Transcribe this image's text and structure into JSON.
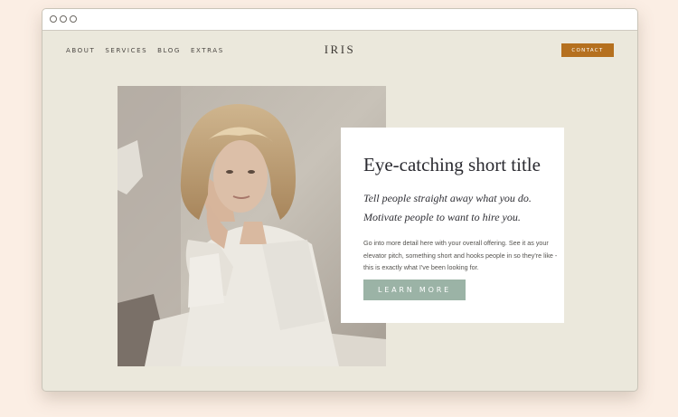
{
  "nav": {
    "items": [
      {
        "label": "ABOUT"
      },
      {
        "label": "SERVICES"
      },
      {
        "label": "BLOG"
      },
      {
        "label": "EXTRAS"
      }
    ],
    "contact_label": "CONTACT"
  },
  "logo": "IRIS",
  "hero": {
    "title": "Eye-catching short title",
    "tagline": "Tell people straight away what you do. Motivate people to want to hire you.",
    "body": "Go into more detail here with your overall offering. See it as your elevator pitch, something short and hooks people in so they're like - this is exactly what I've been looking for.",
    "cta_label": "LEARN MORE"
  },
  "colors": {
    "page_bg": "#fbeee4",
    "site_bg": "#ebe8dc",
    "contact_button": "#b5701f",
    "cta_button": "#9bb3a6"
  },
  "icons": {
    "window_controls": [
      "window-dot-icon",
      "window-dot-icon",
      "window-dot-icon"
    ]
  }
}
